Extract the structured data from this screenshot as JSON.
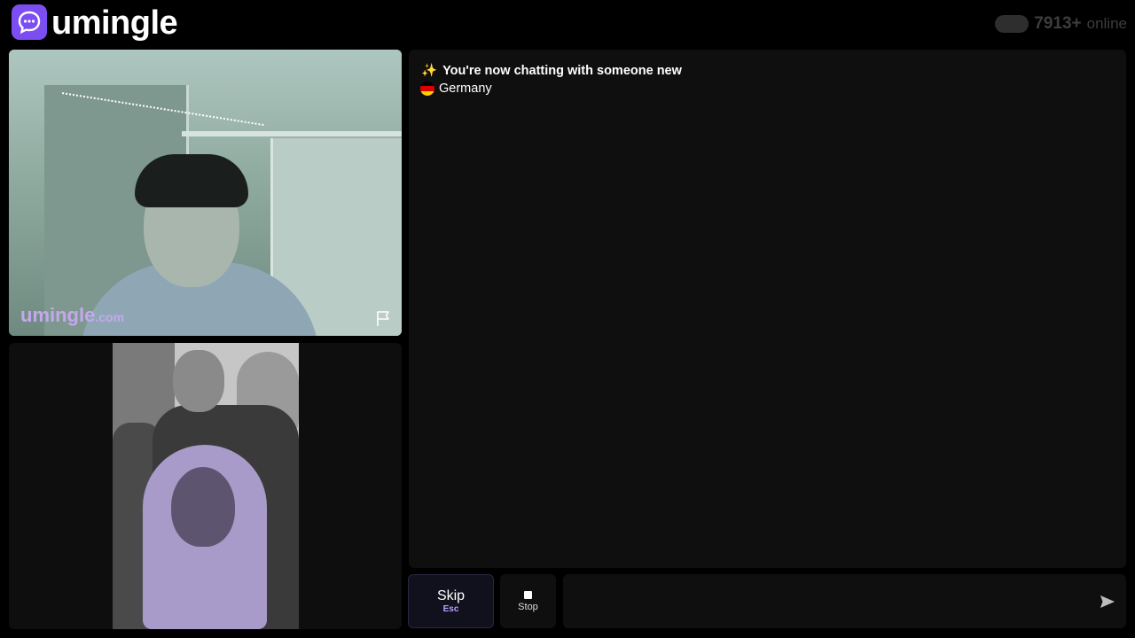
{
  "header": {
    "brand": "umingle",
    "online_count": "7913+",
    "online_label": "online"
  },
  "remote_video": {
    "watermark_main": "umingle",
    "watermark_suffix": ".com"
  },
  "chat": {
    "status_icon": "✨",
    "status_text": "You're now chatting with someone new",
    "country": "Germany"
  },
  "controls": {
    "skip_label": "Skip",
    "skip_hint": "Esc",
    "stop_label": "Stop",
    "message_placeholder": ""
  },
  "colors": {
    "brand_purple": "#7c4df0",
    "accent_lilac": "#b9a0ff"
  },
  "icons": {
    "logo": "chat-bubble-icon",
    "report": "flag-icon",
    "stop": "stop-square-icon",
    "send": "send-arrow-icon"
  }
}
